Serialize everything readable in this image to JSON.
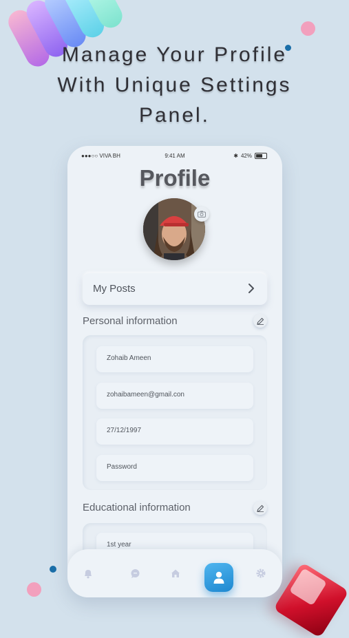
{
  "headline": {
    "line1": "Manage Your Profile",
    "line2": "With Unique Settings",
    "line3": "Panel."
  },
  "status_bar": {
    "carrier": "●●●○○ VIVA BH",
    "time": "9:41 AM",
    "battery": "42%"
  },
  "profile": {
    "title": "Profile"
  },
  "my_posts": {
    "label": "My Posts"
  },
  "personal_information": {
    "heading": "Personal information",
    "fields": {
      "name": "Zohaib Ameen",
      "email": "zohaibameen@gmail.con",
      "dob": "27/12/1997",
      "password": "Password"
    }
  },
  "educational_information": {
    "heading": "Educational information",
    "fields": {
      "year": "1st year"
    }
  },
  "bottom_nav": {
    "items": [
      "bell-icon",
      "chat-icon",
      "home-icon",
      "profile-icon",
      "gear-icon"
    ],
    "active": "profile-icon"
  },
  "colors": {
    "background": "#d3e1ec",
    "accent": "#1e88d0",
    "decor_pink": "#f2a0bd",
    "decor_blue": "#1a6ea8",
    "decor_red": "#d0102b"
  }
}
